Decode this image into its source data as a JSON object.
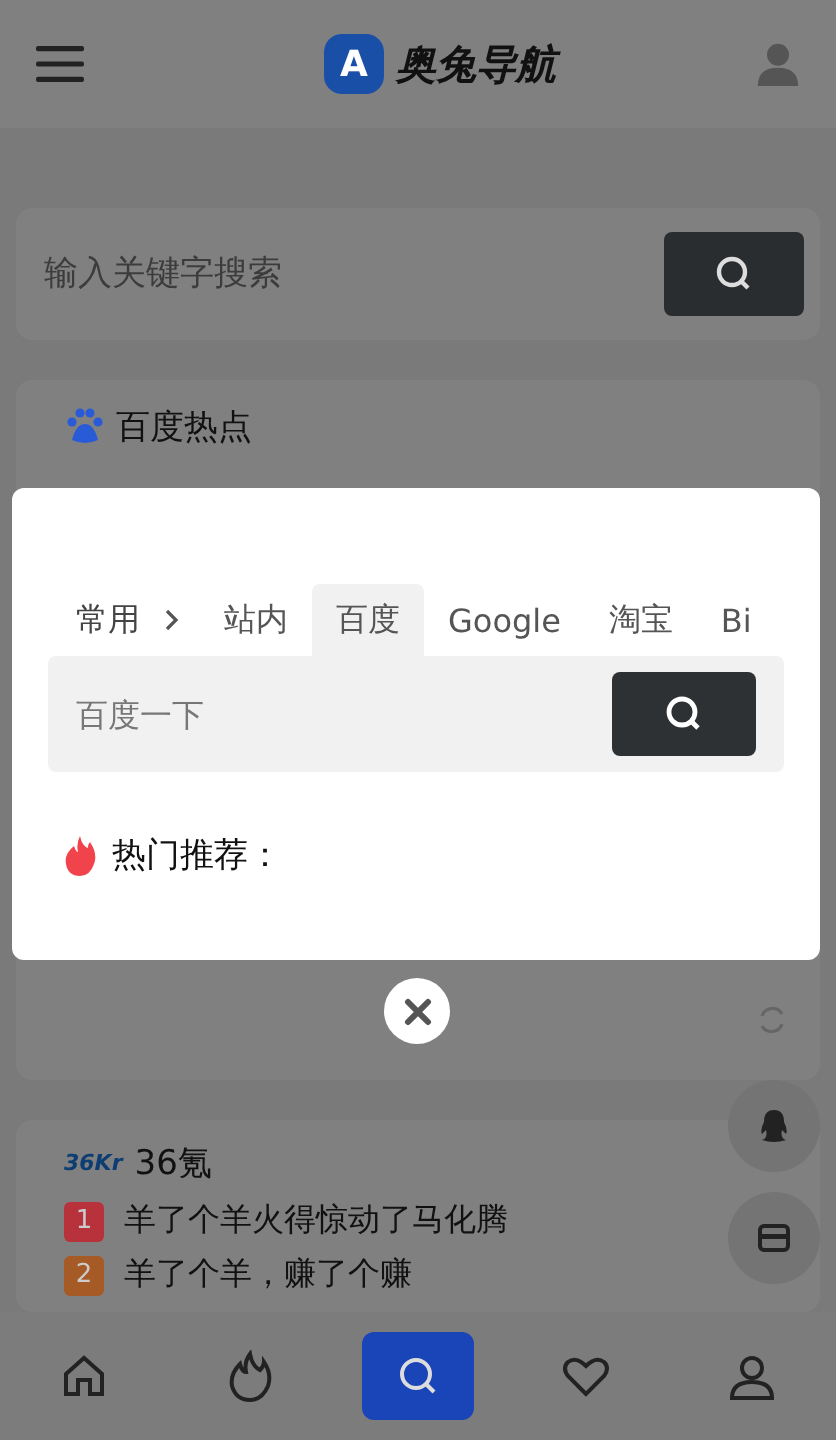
{
  "header": {
    "logo_letter": "A",
    "title": "奥兔导航"
  },
  "search": {
    "placeholder": "输入关键字搜索"
  },
  "baidu_card": {
    "title": "百度热点"
  },
  "kr_card": {
    "logo": "36Kr",
    "title": "36氪",
    "items": [
      {
        "rank": "1",
        "text": "羊了个羊火得惊动了马化腾",
        "color": "#b8323c"
      },
      {
        "rank": "2",
        "text": "羊了个羊，赚了个赚",
        "color": "#a65a25"
      }
    ]
  },
  "side_buttons": [
    {
      "kind": "qq"
    },
    {
      "kind": "card"
    }
  ],
  "bottom_nav": [
    {
      "kind": "home",
      "selected": false
    },
    {
      "kind": "fire",
      "selected": false
    },
    {
      "kind": "search",
      "selected": true
    },
    {
      "kind": "heart",
      "selected": false
    },
    {
      "kind": "user",
      "selected": false
    }
  ],
  "modal": {
    "category": "常用",
    "tabs": [
      {
        "label": "站内",
        "selected": false
      },
      {
        "label": "百度",
        "selected": true
      },
      {
        "label": "Google",
        "selected": false
      },
      {
        "label": "淘宝",
        "selected": false
      },
      {
        "label": "Bi",
        "selected": false
      }
    ],
    "placeholder": "百度一下",
    "hot_label": "热门推荐："
  }
}
